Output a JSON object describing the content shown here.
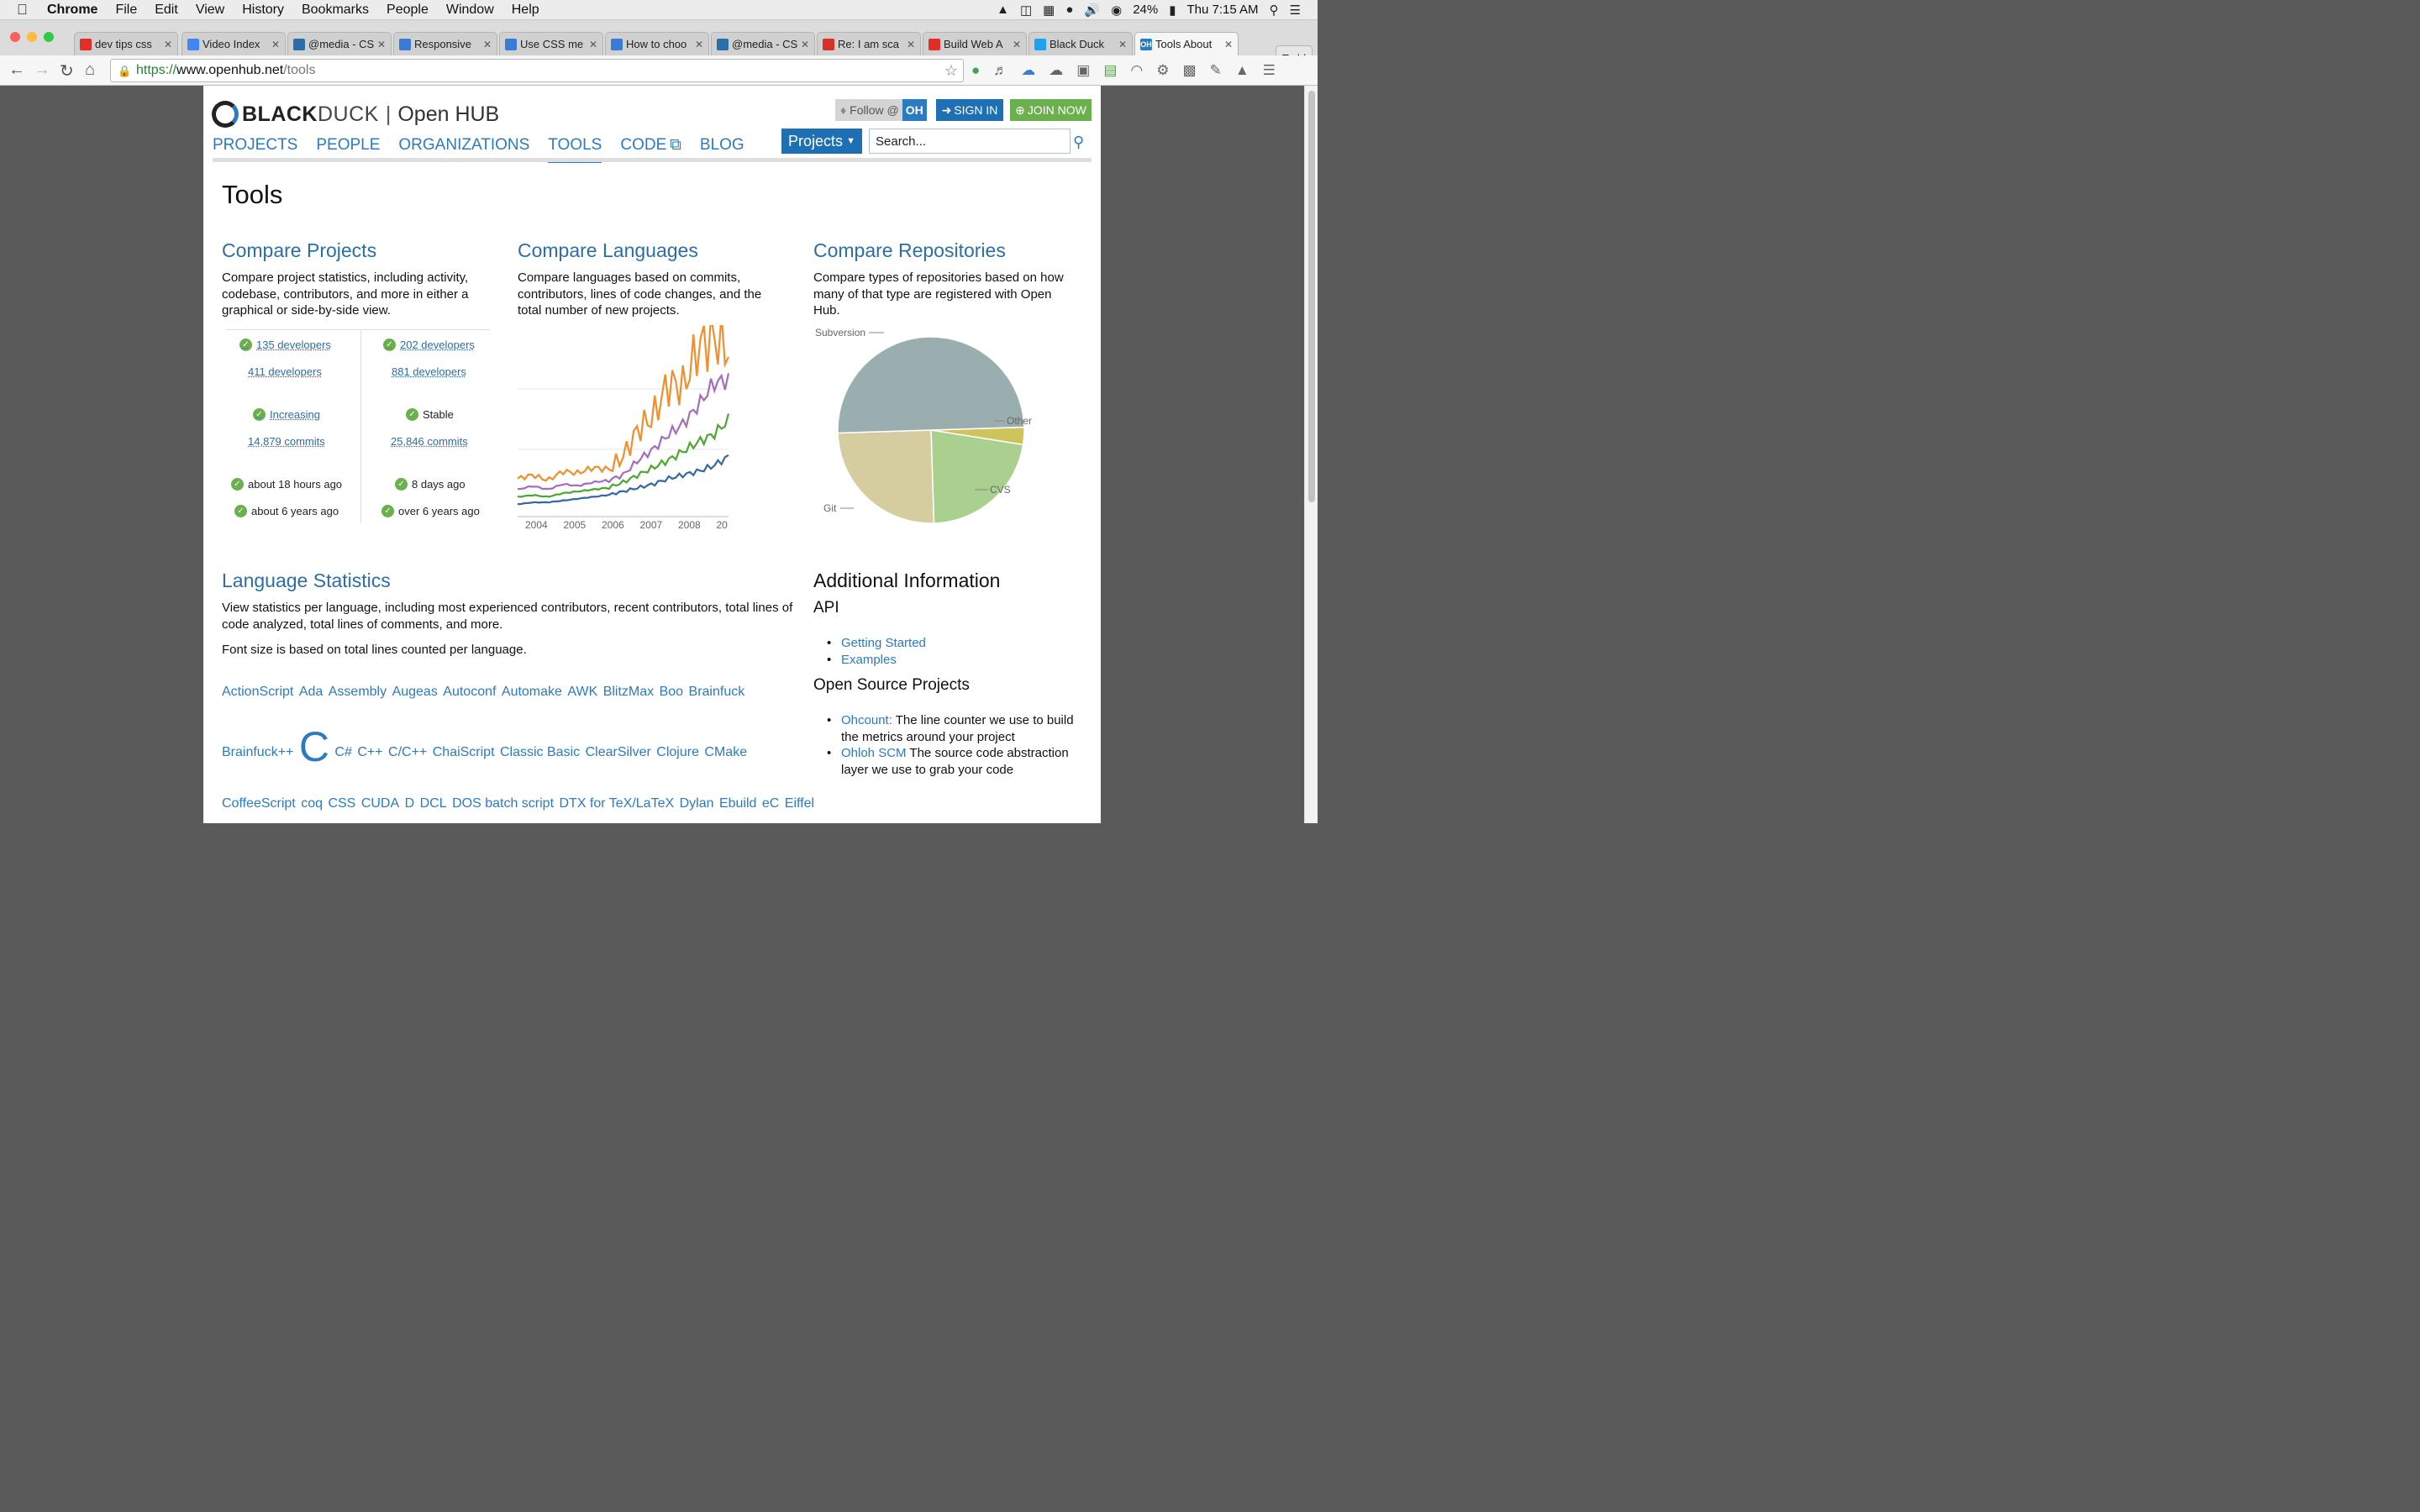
{
  "menubar": {
    "app": "Chrome",
    "items": [
      "File",
      "Edit",
      "View",
      "History",
      "Bookmarks",
      "People",
      "Window",
      "Help"
    ],
    "battery": "24%",
    "clock": "Thu 7:15 AM"
  },
  "tabs": [
    {
      "label": "dev tips css",
      "fav_color": "#e52d27",
      "fav_icon": "youtube-icon"
    },
    {
      "label": "Video Index",
      "fav_color": "#4285f4",
      "fav_icon": "docs-icon"
    },
    {
      "label": "@media - CS",
      "fav_color": "#2b6ea8",
      "fav_icon": "site-icon"
    },
    {
      "label": "Responsive",
      "fav_color": "#3a7bd5",
      "fav_icon": "gear-icon"
    },
    {
      "label": "Use CSS me",
      "fav_color": "#3a7bd5",
      "fav_icon": "gear-icon"
    },
    {
      "label": "How to choo",
      "fav_color": "#3a7bd5",
      "fav_icon": "gear-icon"
    },
    {
      "label": "@media - CS",
      "fav_color": "#2b6ea8",
      "fav_icon": "site-icon"
    },
    {
      "label": "Re: I am sca",
      "fav_color": "#d93025",
      "fav_icon": "gmail-icon"
    },
    {
      "label": "Build Web A",
      "fav_color": "#e52d27",
      "fav_icon": "youtube-icon"
    },
    {
      "label": "Black Duck",
      "fav_color": "#1da1f2",
      "fav_icon": "twitter-icon"
    },
    {
      "label": "Tools About",
      "fav_color": "#2b7bc2",
      "fav_icon": "openhub-icon",
      "fav_text": "OH",
      "active": true
    }
  ],
  "profile": "Todd",
  "url": {
    "scheme": "https://",
    "host": "www.openhub.net",
    "path": "/tools"
  },
  "header": {
    "logo_bold": "BLACK",
    "logo_light": "DUCK",
    "logo_sep": "|",
    "logo_product": "Open HUB",
    "follow": "Follow @",
    "follow_oh": "OH",
    "signin": "SIGN IN",
    "join": "JOIN NOW",
    "nav": [
      "PROJECTS",
      "PEOPLE",
      "ORGANIZATIONS",
      "TOOLS",
      "CODE",
      "BLOG"
    ],
    "projects_select": "Projects",
    "search_placeholder": "Search..."
  },
  "page_title": "Tools",
  "compare_projects": {
    "title": "Compare Projects",
    "desc": "Compare project statistics, including activity, codebase, contributors, and more in either a graphical or side-by-side view.",
    "left": [
      "135 developers",
      "411 developers",
      "Increasing",
      "14,879 commits",
      "about 18 hours ago",
      "about 6 years ago"
    ],
    "right": [
      "202 developers",
      "881 developers",
      "Stable",
      "25,846 commits",
      "8 days ago",
      "over 6 years ago"
    ]
  },
  "compare_languages": {
    "title": "Compare Languages",
    "desc": "Compare languages based on commits, contributors, lines of code changes, and the total number of new projects."
  },
  "compare_repositories": {
    "title": "Compare Repositories",
    "desc": "Compare types of repositories based on how many of that type are registered with Open Hub."
  },
  "chart_data": [
    {
      "type": "line",
      "x_ticks": [
        "2004",
        "2005",
        "2006",
        "2007",
        "2008",
        "20"
      ],
      "series_colors": [
        "#f28e2b",
        "#a66bbe",
        "#4aa82e",
        "#3466a8"
      ],
      "series": [
        {
          "values": [
            18,
            20,
            17,
            22,
            21,
            24,
            23,
            30,
            45,
            52,
            70,
            68,
            90,
            95,
            88
          ]
        },
        {
          "values": [
            12,
            14,
            12,
            15,
            14,
            16,
            17,
            20,
            28,
            34,
            42,
            48,
            58,
            70,
            72
          ]
        },
        {
          "values": [
            8,
            9,
            8,
            10,
            11,
            12,
            13,
            16,
            20,
            24,
            28,
            33,
            38,
            42,
            50
          ]
        },
        {
          "values": [
            4,
            5,
            5,
            6,
            7,
            8,
            9,
            11,
            13,
            15,
            18,
            20,
            22,
            25,
            30
          ]
        }
      ]
    },
    {
      "type": "pie",
      "labels": [
        "Subversion",
        "Other",
        "CVS",
        "Git"
      ],
      "values": [
        50,
        3,
        22,
        25
      ],
      "colors": [
        "#9aadaf",
        "#cfc45c",
        "#a9d08e",
        "#d5cca0"
      ]
    }
  ],
  "language_stats": {
    "title": "Language Statistics",
    "desc": "View statistics per language, including most experienced contributors, recent contributors, total lines of code analyzed, total lines of comments, and more.",
    "font_note": "Font size is based on total lines counted per language.",
    "rows": [
      [
        "ActionScript",
        "Ada",
        "Assembly",
        "Augeas",
        "Autoconf",
        "Automake",
        "AWK",
        "BlitzMax",
        "Boo",
        "Brainfuck"
      ],
      [
        "Brainfuck++",
        "C",
        "C#",
        "C++",
        "C/C++",
        "ChaiScript",
        "Classic Basic",
        "ClearSilver",
        "Clojure",
        "CMake"
      ],
      [
        "CoffeeScript",
        "coq",
        "CSS",
        "CUDA",
        "D",
        "DCL",
        "DOS batch script",
        "DTX for TeX/LaTeX",
        "Dylan",
        "Ebuild",
        "eC",
        "Eiffel"
      ]
    ]
  },
  "additional": {
    "title": "Additional Information",
    "api": "API",
    "api_links": [
      "Getting Started",
      "Examples"
    ],
    "osp": "Open Source Projects",
    "osp_items": [
      {
        "link": "Ohcount:",
        "text": " The line counter we use to build the metrics around your project"
      },
      {
        "link": "Ohloh SCM",
        "text": " The source code abstraction layer we use to grab your code"
      }
    ]
  }
}
